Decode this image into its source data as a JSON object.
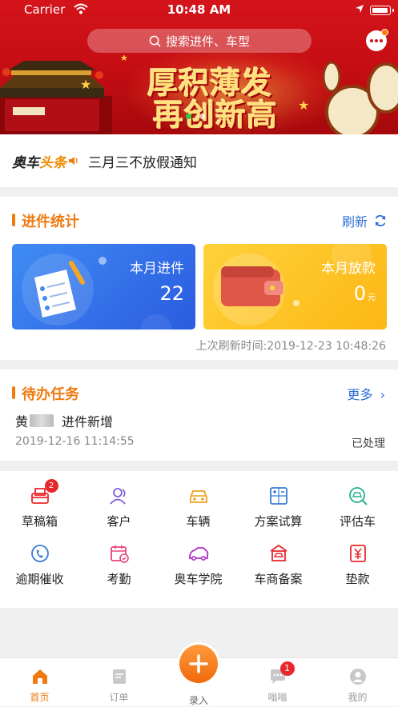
{
  "status_bar": {
    "carrier": "Carrier",
    "time": "10:48 AM"
  },
  "banner": {
    "search_placeholder": "搜索进件、车型",
    "slogan_line1": "厚积薄发",
    "slogan_line2": "再创新高",
    "active_slide": 1,
    "slide_count": 2
  },
  "headline": {
    "brand_a": "奥车",
    "brand_b": "头条",
    "text": "三月三不放假通知"
  },
  "stats": {
    "title": "进件统计",
    "refresh_label": "刷新",
    "cards": [
      {
        "label": "本月进件",
        "value": "22",
        "unit": ""
      },
      {
        "label": "本月放款",
        "value": "0",
        "unit": "元"
      }
    ],
    "last_refresh": "上次刷新时间:2019-12-23 10:48:26"
  },
  "todo": {
    "title": "待办任务",
    "more_label": "更多",
    "item": {
      "name": "黄",
      "action": "进件新增",
      "date": "2019-12-16 11:14:55",
      "status": "已处理"
    }
  },
  "grid": [
    {
      "label": "草稿箱",
      "icon": "drafts-icon",
      "badge": "2"
    },
    {
      "label": "客户",
      "icon": "customer-icon"
    },
    {
      "label": "车辆",
      "icon": "vehicle-icon"
    },
    {
      "label": "方案试算",
      "icon": "calculator-icon"
    },
    {
      "label": "评估车",
      "icon": "appraise-car-icon"
    },
    {
      "label": "逾期催收",
      "icon": "phone-icon"
    },
    {
      "label": "考勤",
      "icon": "attendance-icon"
    },
    {
      "label": "奥车学院",
      "icon": "academy-car-icon"
    },
    {
      "label": "车商备案",
      "icon": "dealer-record-icon"
    },
    {
      "label": "垫款",
      "icon": "advance-payment-icon"
    }
  ],
  "tabbar": {
    "tabs": [
      {
        "label": "首页",
        "icon": "home-icon"
      },
      {
        "label": "订单",
        "icon": "order-icon"
      },
      {
        "label": "录入",
        "icon": "plus-icon"
      },
      {
        "label": "嗡嗡",
        "icon": "message-icon",
        "badge": "1"
      },
      {
        "label": "我的",
        "icon": "profile-icon"
      }
    ],
    "active": "首页"
  },
  "colors": {
    "accent": "#f07a10",
    "link": "#2f6fd6",
    "banner_red": "#d4141a",
    "badge_red": "#e8282d"
  }
}
